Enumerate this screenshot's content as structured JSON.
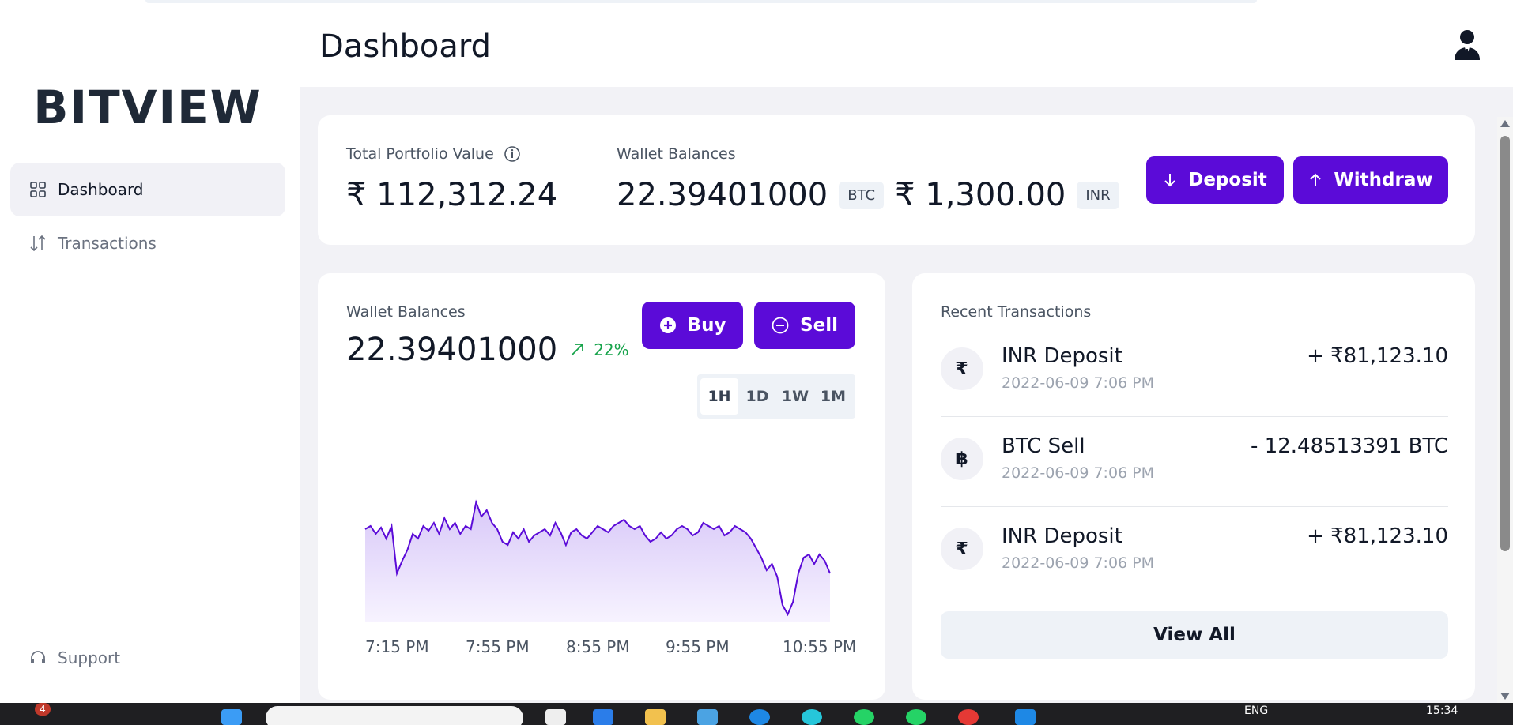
{
  "app": {
    "logo": "BITVIEW",
    "page_title": "Dashboard"
  },
  "sidebar": {
    "items": [
      {
        "label": "Dashboard",
        "icon": "grid-icon",
        "active": true
      },
      {
        "label": "Transactions",
        "icon": "arrows-up-down-icon",
        "active": false
      }
    ],
    "support_label": "Support"
  },
  "portfolio": {
    "total_label": "Total Portfolio Value",
    "total_value": "₹ 112,312.24",
    "wallet_label": "Wallet Balances",
    "btc_value": "22.39401000",
    "btc_tag": "BTC",
    "inr_value": "₹ 1,300.00",
    "inr_tag": "INR",
    "deposit_label": "Deposit",
    "withdraw_label": "Withdraw"
  },
  "wallet_card": {
    "label": "Wallet Balances",
    "value": "22.39401000",
    "change": "22%",
    "buy_label": "Buy",
    "sell_label": "Sell",
    "timeframes": [
      "1H",
      "1D",
      "1W",
      "1M"
    ],
    "active_timeframe": "1H"
  },
  "chart_data": {
    "type": "area",
    "title": "",
    "xlabel": "",
    "ylabel": "",
    "x_ticks": [
      "7:15 PM",
      "7:55 PM",
      "8:55 PM",
      "9:55 PM",
      "10:55 PM"
    ],
    "values": [
      58,
      60,
      55,
      59,
      52,
      60,
      30,
      38,
      45,
      55,
      52,
      60,
      57,
      62,
      55,
      65,
      58,
      62,
      55,
      60,
      58,
      75,
      66,
      70,
      62,
      58,
      50,
      48,
      56,
      52,
      58,
      50,
      54,
      56,
      58,
      54,
      62,
      56,
      48,
      56,
      58,
      54,
      52,
      56,
      60,
      58,
      56,
      60,
      62,
      64,
      60,
      58,
      60,
      54,
      50,
      52,
      56,
      52,
      54,
      58,
      60,
      58,
      54,
      56,
      62,
      60,
      58,
      60,
      54,
      56,
      60,
      58,
      56,
      52,
      46,
      40,
      32,
      36,
      28,
      10,
      4,
      12,
      30,
      40,
      42,
      36,
      42,
      38,
      30
    ],
    "colors": {
      "line": "#5b0bd8",
      "fill_top": "#d8c8f8",
      "fill_bottom": "#f7f3ff"
    }
  },
  "recent": {
    "title": "Recent Transactions",
    "transactions": [
      {
        "icon": "rupee-icon",
        "glyph": "₹",
        "title": "INR Deposit",
        "date": "2022-06-09 7:06 PM",
        "amount": "+ ₹81,123.10"
      },
      {
        "icon": "bitcoin-icon",
        "glyph": "฿",
        "title": "BTC Sell",
        "date": "2022-06-09 7:06 PM",
        "amount": "- 12.48513391 BTC"
      },
      {
        "icon": "rupee-icon",
        "glyph": "₹",
        "title": "INR Deposit",
        "date": "2022-06-09 7:06 PM",
        "amount": "+ ₹81,123.10"
      }
    ],
    "view_all_label": "View All"
  },
  "taskbar": {
    "badge": "4",
    "lang": "ENG",
    "time": "15:34"
  },
  "colors": {
    "accent": "#5b0bd8",
    "positive": "#16a34a",
    "background": "#f2f2f6"
  }
}
